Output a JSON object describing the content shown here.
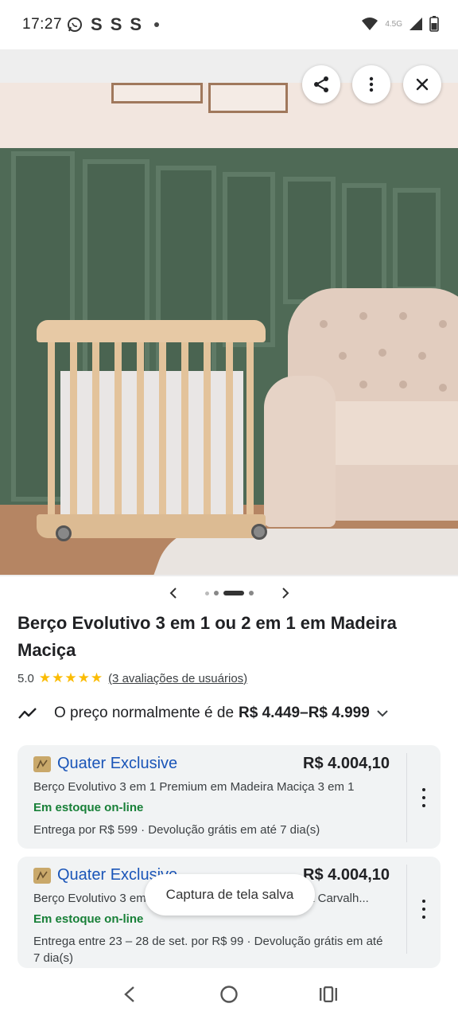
{
  "status_bar": {
    "time": "17:27",
    "notification_icons": [
      "whatsapp-icon",
      "s-app-icon",
      "s-app-icon",
      "s-app-icon"
    ],
    "notification_letters": [
      "S",
      "S",
      "S"
    ],
    "network_label": "4.5G"
  },
  "hero": {
    "buttons": [
      "share-icon",
      "more-vertical-icon",
      "close-icon"
    ]
  },
  "carousel": {
    "dot_count": 5,
    "active_index": 2
  },
  "product": {
    "title": "Berço Evolutivo 3 em 1 ou 2 em 1 em Madeira Maciça",
    "rating": "5.0",
    "stars": "★★★★★",
    "reviews_link": "(3 avaliações de usuários)"
  },
  "price_history": {
    "label": "O preço normalmente é de",
    "range": "R$ 4.449–R$ 4.999"
  },
  "offers": [
    {
      "merchant": "Quater Exclusive",
      "price": "R$ 4.004,10",
      "description": "Berço Evolutivo 3 em 1 Premium em Madeira Maciça 3 em 1",
      "stock": "Em estoque on-line",
      "shipping": "Entrega por R$ 599 · Devolução grátis em até 7 dia(s)"
    },
    {
      "merchant": "Quater Exclusive",
      "price": "R$ 4.004,10",
      "description": "Berço Evolutivo 3 em 1 Premium em Madeira Maciça Carvalh...",
      "stock": "Em estoque on-line",
      "shipping": "Entrega entre 23 – 28 de set. por R$ 99 · Devolução grátis em até 7 dia(s)"
    }
  ],
  "toast": {
    "message": "Captura de tela salva"
  },
  "nav_bar": {
    "buttons": [
      "back-icon",
      "home-icon",
      "recents-icon"
    ]
  },
  "colors": {
    "link_blue": "#1a55b8",
    "stock_green": "#188038",
    "star_yellow": "#fbbc04",
    "card_bg": "#f1f3f4"
  }
}
